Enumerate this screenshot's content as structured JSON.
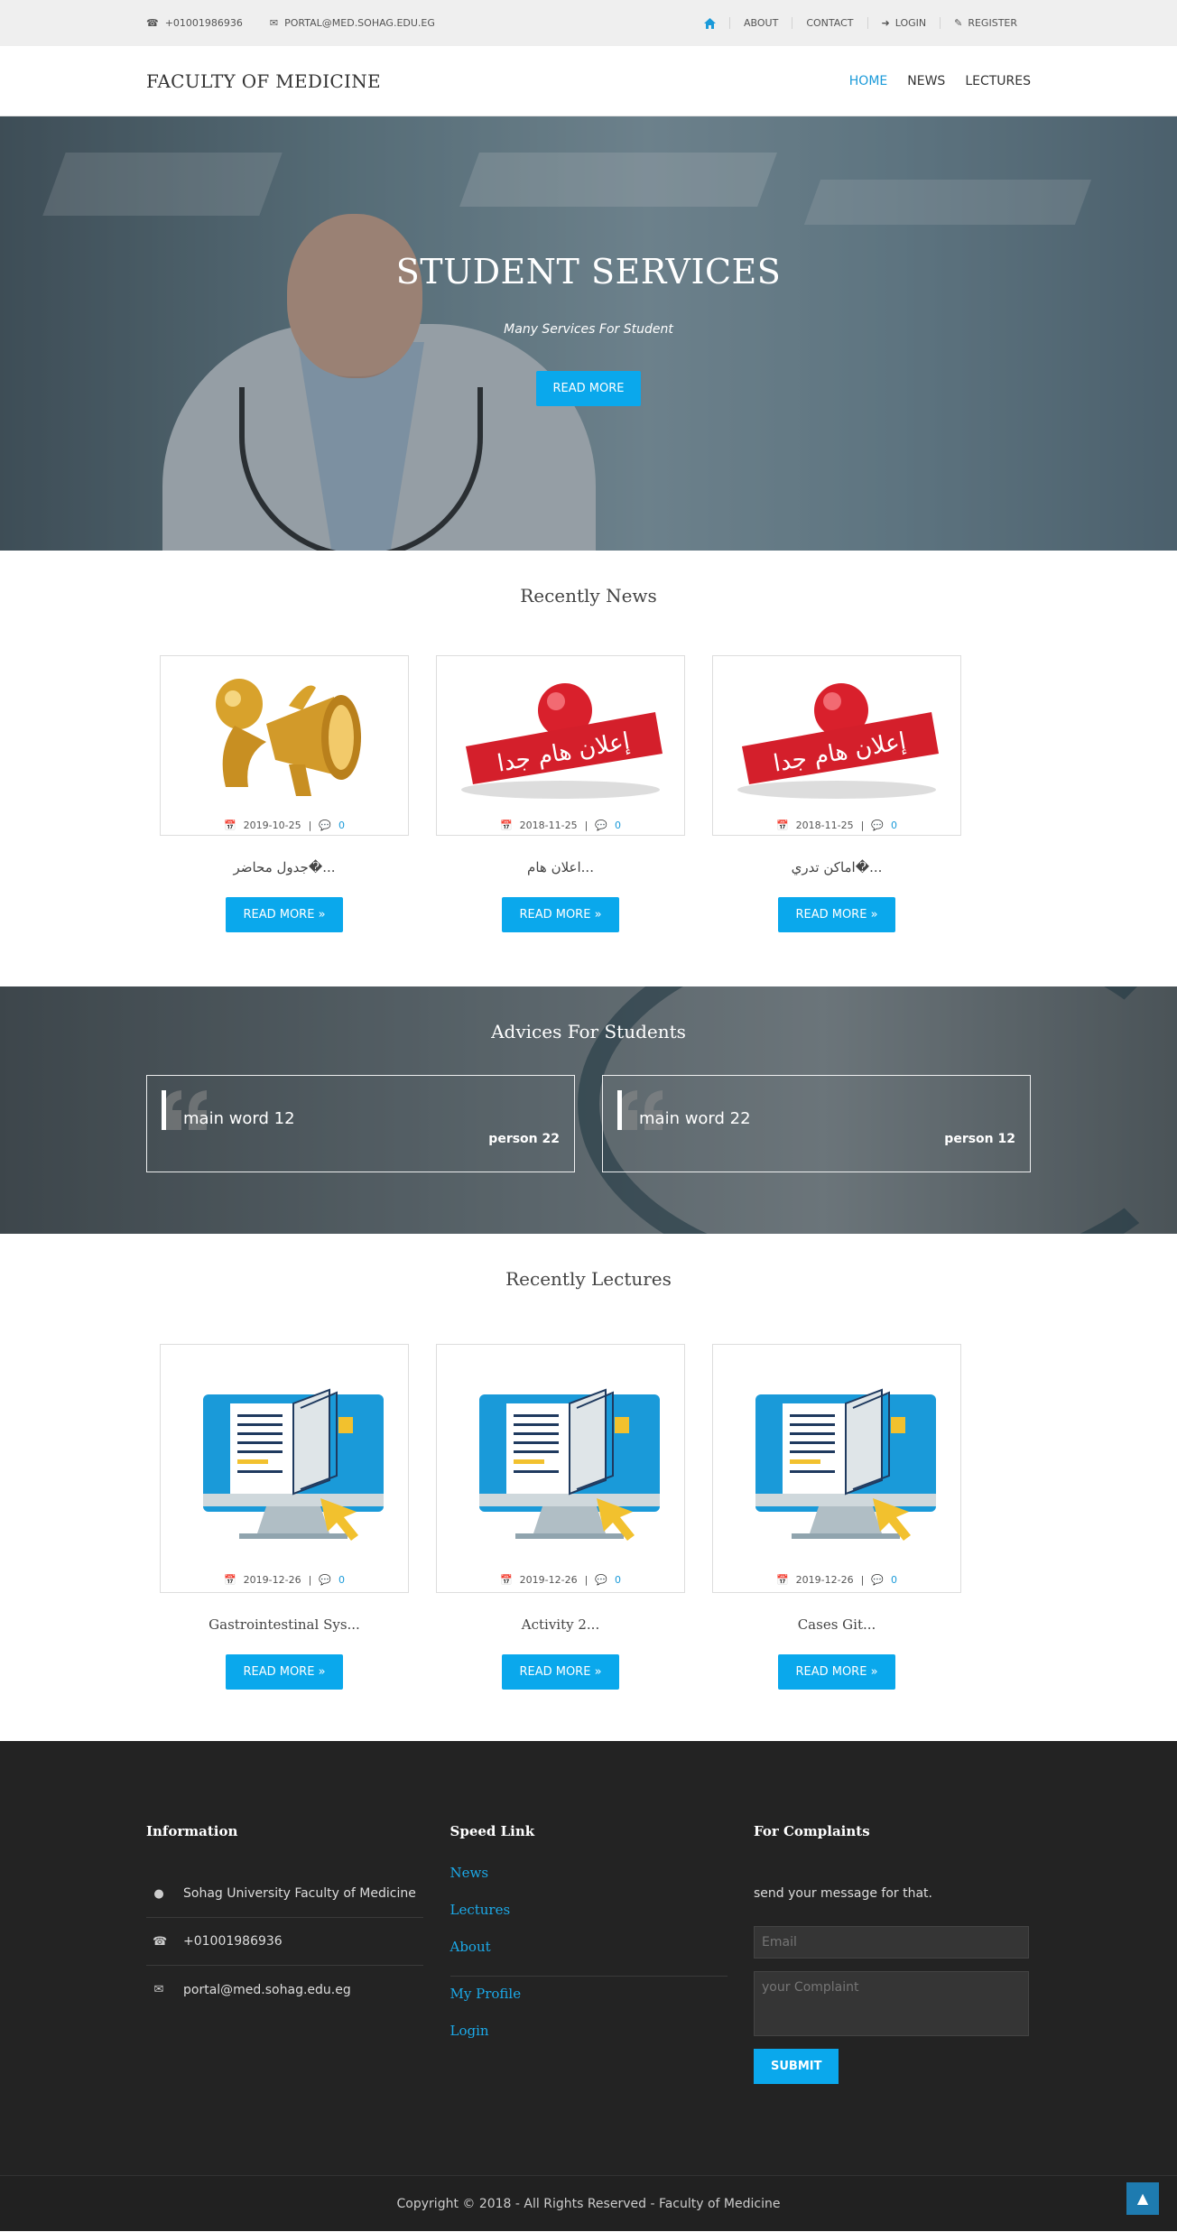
{
  "topbar": {
    "phone": "+01001986936",
    "email": "PORTAL@MED.SOHAG.EDU.EG",
    "nav": [
      "ABOUT",
      "CONTACT",
      "LOGIN",
      "REGISTER"
    ]
  },
  "header": {
    "brand": "FACULTY OF MEDICINE",
    "nav": [
      "HOME",
      "NEWS",
      "LECTURES"
    ]
  },
  "hero": {
    "title": "STUDENT SERVICES",
    "subtitle": "Many Services For Student",
    "button": "READ MORE"
  },
  "news": {
    "title": "Recently News",
    "items": [
      {
        "date": "2019-10-25",
        "comments": "0",
        "title": "جدول محاضر�...",
        "button": "READ MORE »"
      },
      {
        "date": "2018-11-25",
        "comments": "0",
        "title": "اعلان هام...",
        "button": "READ MORE »"
      },
      {
        "date": "2018-11-25",
        "comments": "0",
        "title": "اماكن تدري�...",
        "button": "READ MORE »"
      }
    ],
    "announce_text": "إعلان هام جدا"
  },
  "advices": {
    "title": "Advices For Students",
    "items": [
      {
        "text": "main word 12",
        "author": "person 22"
      },
      {
        "text": "main word 22",
        "author": "person 12"
      }
    ]
  },
  "lectures": {
    "title": "Recently Lectures",
    "items": [
      {
        "date": "2019-12-26",
        "comments": "0",
        "title": "Gastrointestinal Sys...",
        "button": "READ MORE »"
      },
      {
        "date": "2019-12-26",
        "comments": "0",
        "title": "Activity 2...",
        "button": "READ MORE »"
      },
      {
        "date": "2019-12-26",
        "comments": "0",
        "title": "Cases Git...",
        "button": "READ MORE »"
      }
    ]
  },
  "footer": {
    "info": {
      "title": "Information",
      "address": "Sohag University Faculty of Medicine",
      "phone": "+01001986936",
      "email": "portal@med.sohag.edu.eg"
    },
    "links": {
      "title": "Speed Link",
      "items": [
        "News",
        "Lectures",
        "About",
        "My Profile",
        "Login"
      ]
    },
    "complaints": {
      "title": "For Complaints",
      "text": "send your message for that.",
      "email_placeholder": "Email",
      "complaint_placeholder": "your Complaint",
      "submit": "SUBMIT"
    },
    "copyright": "Copyright © 2018 - All Rights Reserved - Faculty of Medicine"
  },
  "colors": {
    "accent": "#0aa8ec",
    "link": "#1a9ad9",
    "footer_bg": "#232323",
    "topbar_bg": "#efefef"
  }
}
